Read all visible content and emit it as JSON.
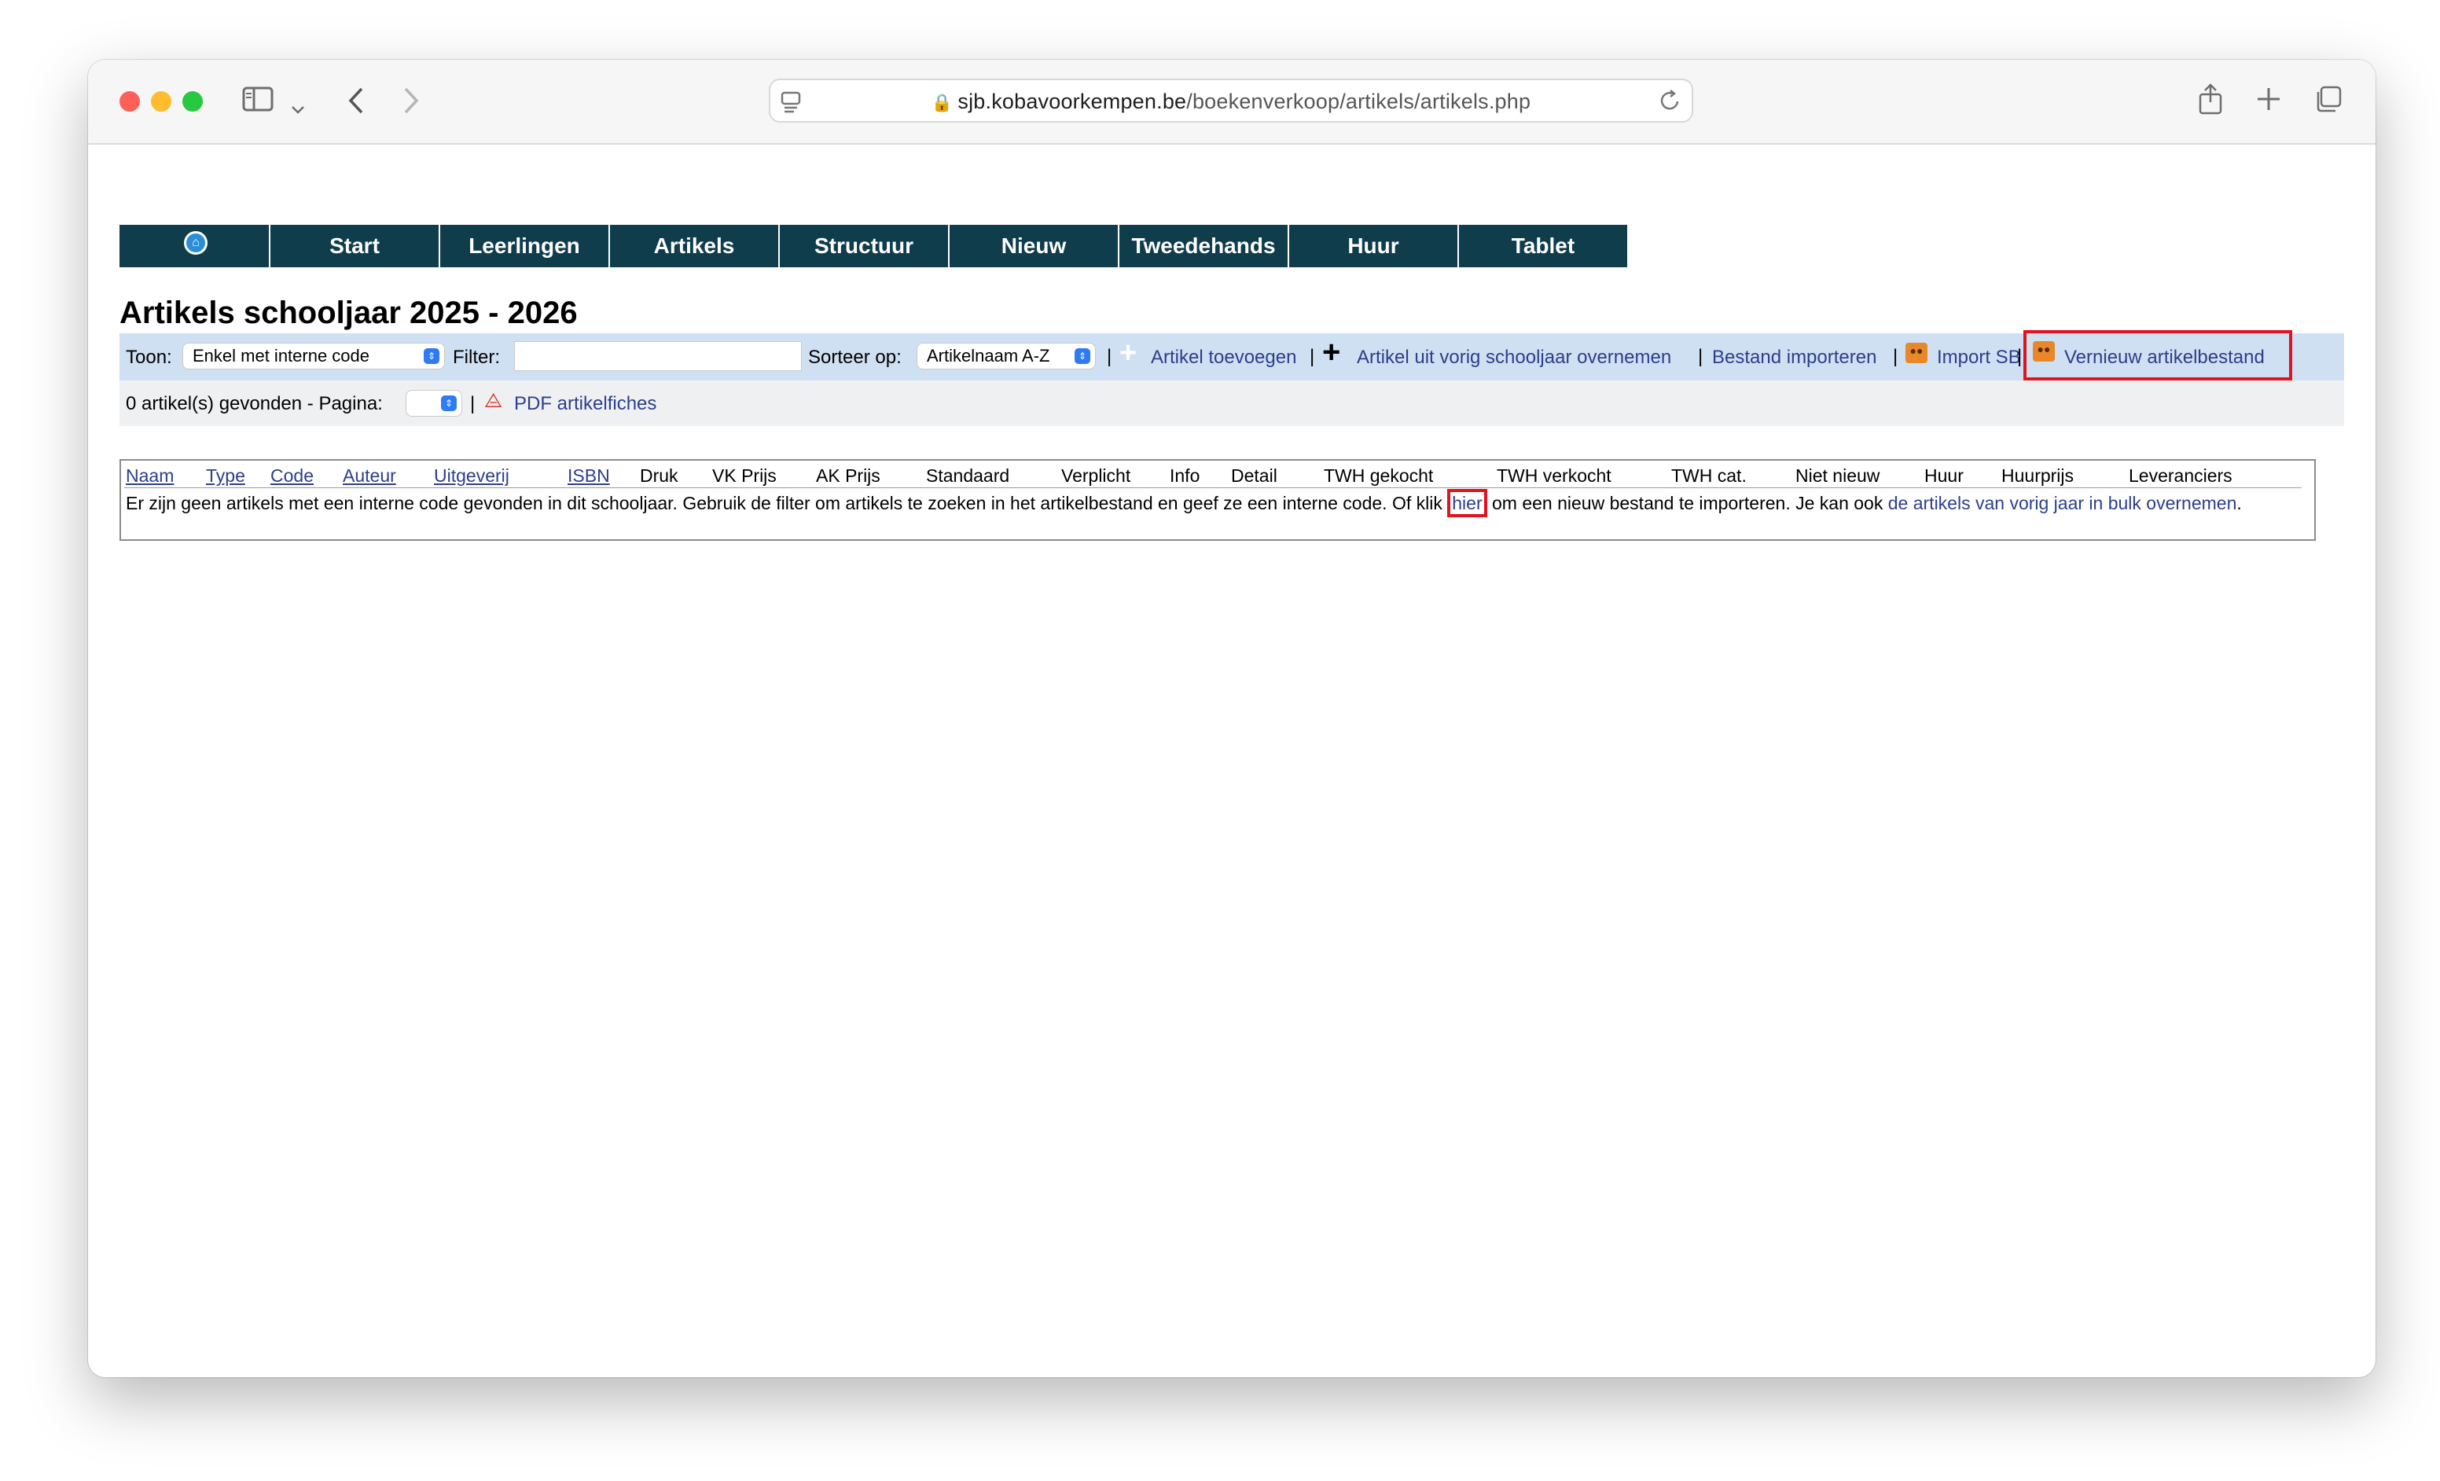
{
  "browser": {
    "url_host": "sjb.kobavoorkempen.be",
    "url_path": "/boekenverkoop/artikels/artikels.php"
  },
  "nav": {
    "items": [
      "Start",
      "Leerlingen",
      "Artikels",
      "Structuur",
      "Nieuw",
      "Tweedehands",
      "Huur",
      "Tablet"
    ]
  },
  "page_title": "Artikels schooljaar 2025 - 2026",
  "filterbar": {
    "toon_label": "Toon:",
    "toon_value": "Enkel met interne code",
    "filter_label": "Filter:",
    "filter_value": "",
    "sort_label": "Sorteer op:",
    "sort_value": "Artikelnaam A-Z",
    "separator": "|",
    "link_add": "Artikel toevoegen",
    "link_copy_prev": "Artikel uit vorig schooljaar overnemen",
    "link_import_file": "Bestand importeren",
    "link_import_sb": "Import SB",
    "link_renew": "Vernieuw artikelbestand"
  },
  "infobar": {
    "count_text": "0 artikel(s) gevonden - Pagina:",
    "page_value": "",
    "pdf_link": "PDF artikelfiches"
  },
  "table": {
    "headers": [
      "Naam",
      "Type",
      "Code",
      "Auteur",
      "Uitgeverij",
      "ISBN",
      "Druk",
      "VK Prijs",
      "AK Prijs",
      "Standaard",
      "Verplicht",
      "Info",
      "Detail",
      "TWH gekocht",
      "TWH verkocht",
      "TWH cat.",
      "Niet nieuw",
      "Huur",
      "Huurprijs",
      "Leveranciers"
    ],
    "message_before": "Er zijn geen artikels met een interne code gevonden in dit schooljaar. Gebruik de filter om artikels te zoeken in het artikelbestand en geef ze een interne code. Of klik ",
    "message_link_hier": "hier",
    "message_middle": " om een nieuw bestand te importeren. Je kan ook ",
    "message_link_bulk": "de artikels van vorig jaar in bulk overnemen",
    "message_end": "."
  },
  "colors": {
    "nav_bg": "#0f3d4c",
    "filterbar_bg": "#cfe0f2",
    "link": "#2c3e8c",
    "highlight": "#e0141e"
  }
}
